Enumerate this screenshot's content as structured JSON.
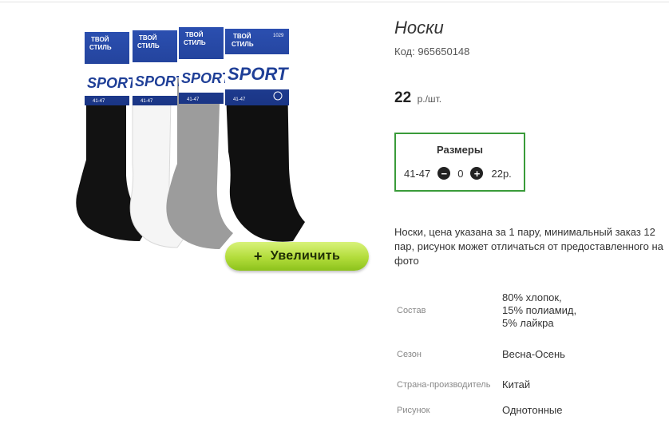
{
  "product": {
    "title": "Носки",
    "code": "Код: 965650148",
    "price_value": "22",
    "price_unit": "р./шт.",
    "zoom_label": "Увеличить",
    "image_alt": "Носки Твой стиль Sport",
    "pack_brand_line1": "ТВОЙ",
    "pack_brand_line2": "СТИЛЬ",
    "pack_logo": "SPORT",
    "pack_size": "41-47",
    "pack_article": "1029"
  },
  "sizes": {
    "title": "Размеры",
    "rows": [
      {
        "size": "41-47",
        "qty": "0",
        "price": "22р."
      }
    ]
  },
  "description": "Носки, цена указана за 1 пару, минимальный заказ 12 пар, рисунок может отличаться от предоставленного на фото",
  "properties": [
    {
      "key": "Состав",
      "value": "80% хлопок, 15% полиамид, 5% лайкра"
    },
    {
      "key": "Сезон",
      "value": "Весна-Осень"
    },
    {
      "key": "Страна-производитель",
      "value": "Китай"
    },
    {
      "key": "Рисунок",
      "value": "Однотонные"
    }
  ],
  "colors": {
    "accent_border": "#3a9b3a",
    "zoom_button": "#b2dc3a",
    "pack_blue": "#1f3f97"
  },
  "icons": {
    "minus": "minus-circle-icon",
    "plus": "plus-circle-icon"
  }
}
